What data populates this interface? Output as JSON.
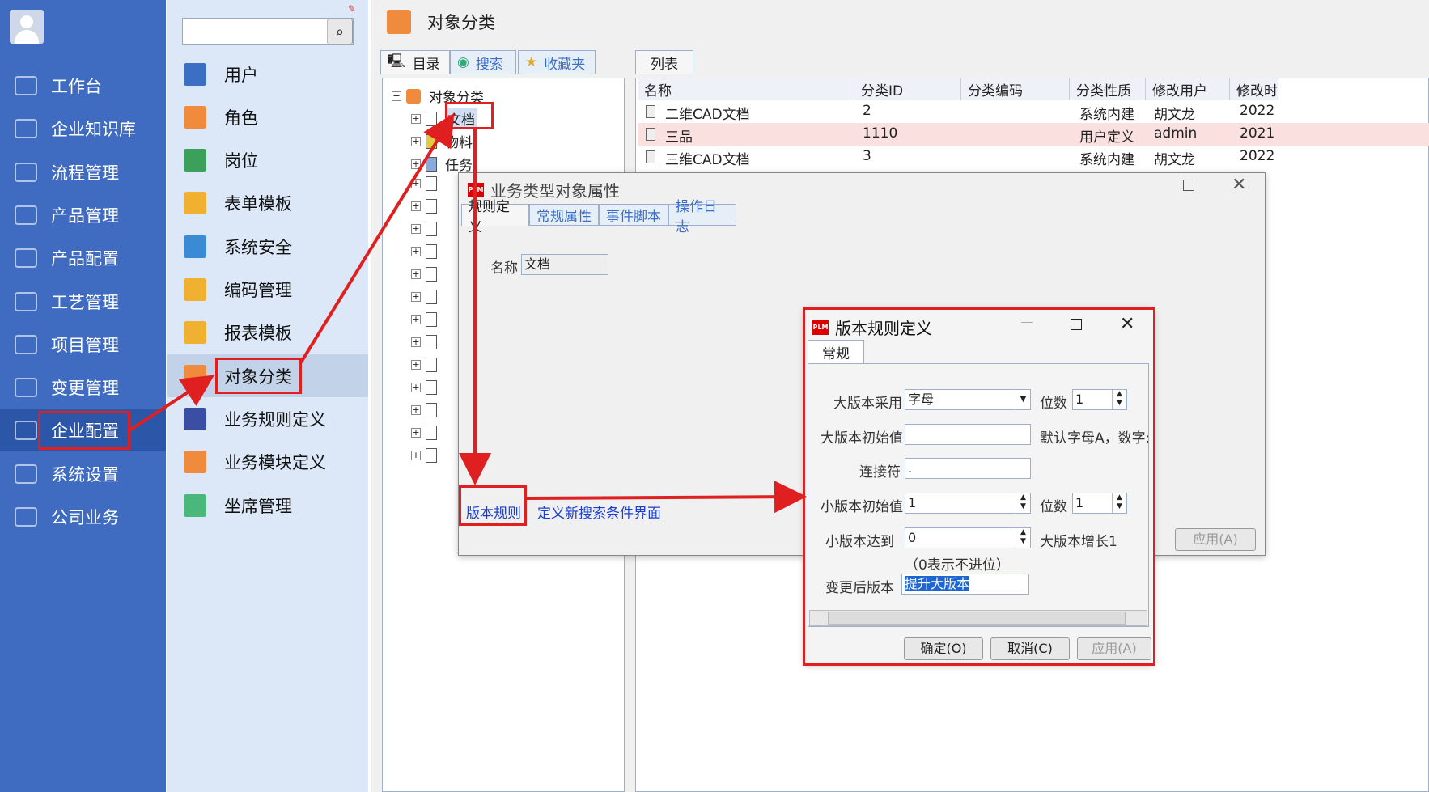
{
  "nav": {
    "items": [
      {
        "label": "工作台",
        "icon": "monitor-icon"
      },
      {
        "label": "企业知识库",
        "icon": "book-icon"
      },
      {
        "label": "流程管理",
        "icon": "flow-icon"
      },
      {
        "label": "产品管理",
        "icon": "cube-icon"
      },
      {
        "label": "产品配置",
        "icon": "sliders-icon"
      },
      {
        "label": "工艺管理",
        "icon": "wrench-icon"
      },
      {
        "label": "项目管理",
        "icon": "chart-icon"
      },
      {
        "label": "变更管理",
        "icon": "swap-icon"
      },
      {
        "label": "企业配置",
        "icon": "users-icon"
      },
      {
        "label": "系统设置",
        "icon": "gear-icon"
      },
      {
        "label": "公司业务",
        "icon": "grid-icon"
      }
    ]
  },
  "sub": {
    "search_value": "",
    "items": [
      {
        "label": "用户",
        "color": "#3a6fc4"
      },
      {
        "label": "角色",
        "color": "#f08a3c"
      },
      {
        "label": "岗位",
        "color": "#3aa05a"
      },
      {
        "label": "表单模板",
        "color": "#f0b030"
      },
      {
        "label": "系统安全",
        "color": "#3a8ad4"
      },
      {
        "label": "编码管理",
        "color": "#f0b030"
      },
      {
        "label": "报表模板",
        "color": "#f0b030"
      },
      {
        "label": "对象分类",
        "color": "#f08a3c"
      },
      {
        "label": "业务规则定义",
        "color": "#3a4fa4"
      },
      {
        "label": "业务模块定义",
        "color": "#f08a3c"
      },
      {
        "label": "坐席管理",
        "color": "#4ab87a"
      }
    ]
  },
  "main": {
    "title": "对象分类",
    "left_tabs": [
      "目录",
      "搜索",
      "收藏夹"
    ],
    "right_tab": "列表",
    "tree": {
      "root": "对象分类",
      "nodes": [
        "文档",
        "物料",
        "任务"
      ]
    },
    "grid": {
      "headers": [
        "名称",
        "分类ID",
        "分类编码",
        "分类性质",
        "修改用户",
        "修改时"
      ],
      "rows": [
        {
          "name": "二维CAD文档",
          "id": "2",
          "code": "",
          "nature": "系统内建",
          "user": "胡文龙",
          "time": "2022"
        },
        {
          "name": "三品",
          "id": "1110",
          "code": "",
          "nature": "用户定义",
          "user": "admin",
          "time": "2021"
        },
        {
          "name": "三维CAD文档",
          "id": "3",
          "code": "",
          "nature": "系统内建",
          "user": "胡文龙",
          "time": "2022"
        }
      ]
    }
  },
  "dialog1": {
    "title": "业务类型对象属性",
    "tabs": [
      "规则定义",
      "常规属性",
      "事件脚本",
      "操作日志"
    ],
    "name_label": "名称",
    "name_value": "文档",
    "link_version": "版本规则",
    "link_search": "定义新搜索条件界面",
    "apply_label": "应用(A)"
  },
  "dialog2": {
    "title": "版本规则定义",
    "tab": "常规",
    "major_label": "大版本采用",
    "major_value": "字母",
    "digits_label": "位数",
    "major_digits": "1",
    "major_init_label": "大版本初始值",
    "major_init_value": "",
    "default_note": "默认字母A，数字:",
    "connector_label": "连接符",
    "connector_value": ".",
    "minor_init_label": "小版本初始值",
    "minor_init_value": "1",
    "minor_digits": "1",
    "minor_reach_label": "小版本达到",
    "minor_reach_value": "0",
    "major_inc_label": "大版本增长1",
    "zero_note": "（0表示不进位）",
    "after_change_label": "变更后版本",
    "after_change_value": "提升大版本",
    "ok_label": "确定(O)",
    "cancel_label": "取消(C)",
    "apply_label": "应用(A)"
  },
  "annotation_color": "#e02020"
}
